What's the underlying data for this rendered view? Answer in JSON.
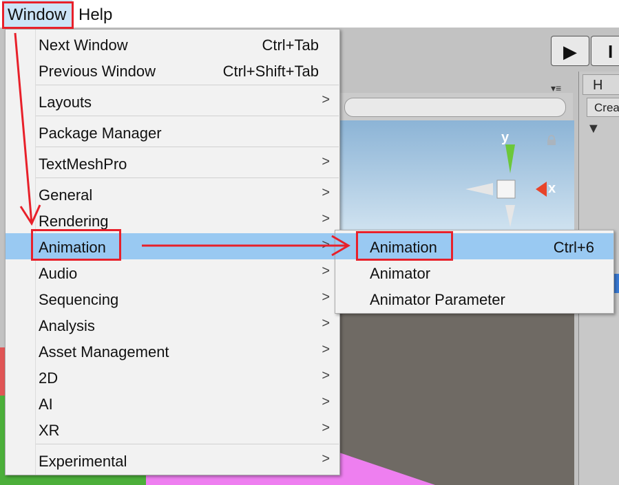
{
  "menubar": {
    "items": [
      {
        "label": "Window"
      },
      {
        "label": "Help"
      }
    ]
  },
  "window_menu": {
    "items": [
      {
        "label": "Next Window",
        "shortcut": "Ctrl+Tab",
        "submenu": false
      },
      {
        "label": "Previous Window",
        "shortcut": "Ctrl+Shift+Tab",
        "submenu": false
      },
      {
        "label": "Layouts",
        "shortcut": "",
        "submenu": true
      },
      {
        "label": "Package Manager",
        "shortcut": "",
        "submenu": false
      },
      {
        "label": "TextMeshPro",
        "shortcut": "",
        "submenu": true
      },
      {
        "label": "General",
        "shortcut": "",
        "submenu": true
      },
      {
        "label": "Rendering",
        "shortcut": "",
        "submenu": true
      },
      {
        "label": "Animation",
        "shortcut": "",
        "submenu": true,
        "highlighted": true
      },
      {
        "label": "Audio",
        "shortcut": "",
        "submenu": true
      },
      {
        "label": "Sequencing",
        "shortcut": "",
        "submenu": true
      },
      {
        "label": "Analysis",
        "shortcut": "",
        "submenu": true
      },
      {
        "label": "Asset Management",
        "shortcut": "",
        "submenu": true
      },
      {
        "label": "2D",
        "shortcut": "",
        "submenu": true
      },
      {
        "label": "AI",
        "shortcut": "",
        "submenu": true
      },
      {
        "label": "XR",
        "shortcut": "",
        "submenu": true
      },
      {
        "label": "Experimental",
        "shortcut": "",
        "submenu": true
      }
    ],
    "arrow_glyph": ">"
  },
  "animation_submenu": {
    "items": [
      {
        "label": "Animation",
        "shortcut": "Ctrl+6",
        "highlighted": true
      },
      {
        "label": "Animator",
        "shortcut": ""
      },
      {
        "label": "Animator Parameter",
        "shortcut": ""
      }
    ]
  },
  "editor": {
    "play_glyph": "▶",
    "pause_glyph": "I",
    "hierarchy_tab": "H",
    "create_label": "Crea",
    "gizmo": {
      "y_label": "y",
      "x_label": "x"
    }
  },
  "colors": {
    "highlight": "#99c9f2",
    "annotation_red": "#e8202a",
    "menu_bg": "#f2f2f2"
  }
}
